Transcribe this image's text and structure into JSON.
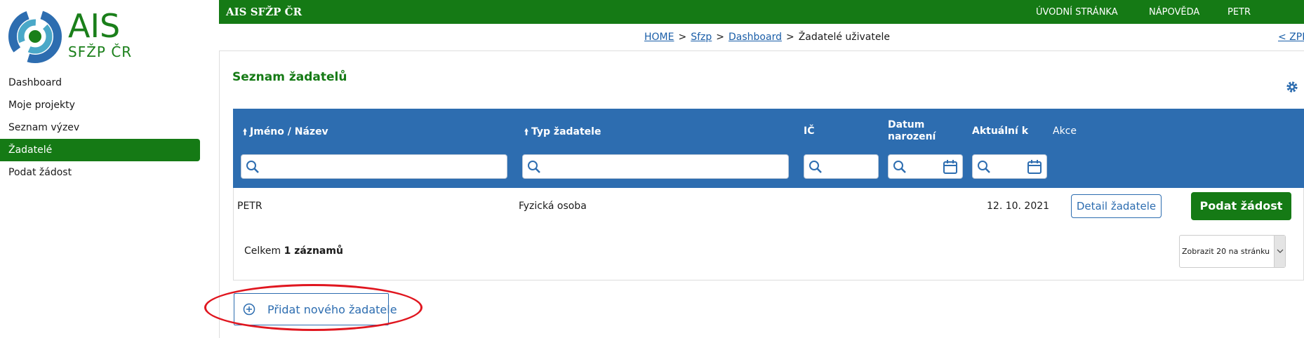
{
  "logo": {
    "title": "AIS",
    "subtitle": "SFŽP ČR"
  },
  "nav": {
    "items": [
      {
        "label": "Dashboard"
      },
      {
        "label": "Moje projekty"
      },
      {
        "label": "Seznam výzev"
      },
      {
        "label": "Žadatelé",
        "active": true
      },
      {
        "label": "Podat žádost"
      }
    ]
  },
  "topbar": {
    "brand": "AIS SFŽP ČR",
    "links": [
      "ÚVODNÍ STRÁNKA",
      "NÁPOVĚDA",
      "PETR"
    ],
    "color": "#157a15"
  },
  "breadcrumb": {
    "items": [
      "HOME",
      "Sfzp",
      "Dashboard"
    ],
    "current": "Žadatelé uživatele",
    "separator": ">",
    "back": "< ZPĚ"
  },
  "page": {
    "title": "Seznam žadatelů"
  },
  "table": {
    "header_color": "#2d6db0",
    "columns": [
      {
        "label": "Jméno / Název",
        "sortable": true
      },
      {
        "label": "Typ žadatele",
        "sortable": true
      },
      {
        "label": "IČ"
      },
      {
        "label_line1": "Datum",
        "label_line2": "narození"
      },
      {
        "label": "Aktuální k"
      },
      {
        "label": "Akce"
      }
    ],
    "rows": [
      {
        "name": "PETR",
        "type": "Fyzická osoba",
        "ic": "",
        "birth": "",
        "current": "12. 10. 2021",
        "detail_button": "Detail žadatele",
        "submit_button": "Podat žádost"
      }
    ],
    "total_prefix": "Celkem",
    "total_count": "1 záznamů",
    "page_size_label": "Zobrazit 20 na stránku"
  },
  "add_button": {
    "label": "Přidat nového žadatele"
  }
}
